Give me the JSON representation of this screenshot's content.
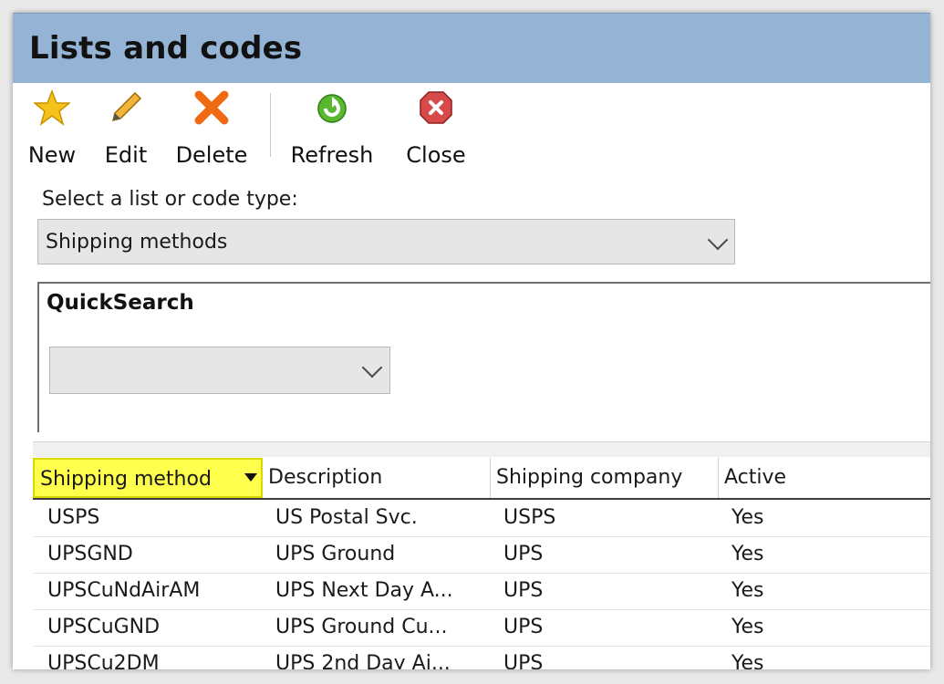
{
  "window": {
    "title": "Lists and codes"
  },
  "toolbar": {
    "new_label": "New",
    "edit_label": "Edit",
    "delete_label": "Delete",
    "refresh_label": "Refresh",
    "close_label": "Close"
  },
  "list_selector": {
    "label": "Select a list or code type:",
    "value": "Shipping methods"
  },
  "quicksearch": {
    "title": "QuickSearch",
    "value": ""
  },
  "table": {
    "columns": [
      "Shipping method",
      "Description",
      "Shipping company",
      "Active"
    ],
    "rows": [
      [
        "USPS",
        "US Postal Svc.",
        "USPS",
        "Yes"
      ],
      [
        "UPSGND",
        "UPS Ground",
        "UPS",
        "Yes"
      ],
      [
        "UPSCuNdAirAM",
        "UPS Next Day A...",
        "UPS",
        "Yes"
      ],
      [
        "UPSCuGND",
        "UPS Ground Cu...",
        "UPS",
        "Yes"
      ],
      [
        "UPSCu2DM",
        "UPS 2nd Day Ai...",
        "UPS",
        "Yes"
      ]
    ]
  },
  "colors": {
    "titlebar": "#95b4d5",
    "highlight": "#ffff4d"
  }
}
